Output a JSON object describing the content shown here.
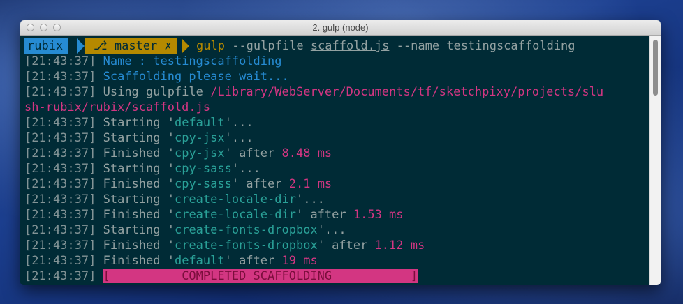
{
  "window": {
    "title": "2. gulp (node)"
  },
  "prompt": {
    "user": "rubix",
    "branch_icon": "branch-icon",
    "branch": "master",
    "dirty_mark": "✗",
    "command": "gulp",
    "arg1": "--gulpfile",
    "file": "scaffold.js",
    "arg2": "--name testingscaffolding"
  },
  "colors": {
    "background": "#002b36",
    "blue": "#268bd2",
    "teal": "#2aa198",
    "magenta": "#d33682",
    "yellow": "#b58900",
    "text": "#93a1a1"
  },
  "lines": [
    {
      "ts": "[21:43:37]",
      "text": "Name : testingscaffolding"
    },
    {
      "ts": "[21:43:37]",
      "text": "Scaffolding please wait..."
    },
    {
      "ts": "[21:43:37]",
      "pre": "Using gulpfile ",
      "path1": "/Library/WebServer/Documents/tf/sketchpixy/projects/slu"
    },
    {
      "path2": "sh-rubix/rubix/scaffold.js"
    },
    {
      "ts": "[21:43:37]",
      "pre": "Starting '",
      "task": "default",
      "post": "'..."
    },
    {
      "ts": "[21:43:37]",
      "pre": "Starting '",
      "task": "cpy-jsx",
      "post": "'..."
    },
    {
      "ts": "[21:43:37]",
      "pre": "Finished '",
      "task": "cpy-jsx",
      "post": "' after ",
      "time": "8.48 ms"
    },
    {
      "ts": "[21:43:37]",
      "pre": "Starting '",
      "task": "cpy-sass",
      "post": "'..."
    },
    {
      "ts": "[21:43:37]",
      "pre": "Finished '",
      "task": "cpy-sass",
      "post": "' after ",
      "time": "2.1 ms"
    },
    {
      "ts": "[21:43:37]",
      "pre": "Starting '",
      "task": "create-locale-dir",
      "post": "'..."
    },
    {
      "ts": "[21:43:37]",
      "pre": "Finished '",
      "task": "create-locale-dir",
      "post": "' after ",
      "time": "1.53 ms"
    },
    {
      "ts": "[21:43:37]",
      "pre": "Starting '",
      "task": "create-fonts-dropbox",
      "post": "'..."
    },
    {
      "ts": "[21:43:37]",
      "pre": "Finished '",
      "task": "create-fonts-dropbox",
      "post": "' after ",
      "time": "1.12 ms"
    },
    {
      "ts": "[21:43:37]",
      "pre": "Finished '",
      "task": "default",
      "post": "' after ",
      "time": "19 ms"
    },
    {
      "ts": "[21:43:37]",
      "banner": "[          COMPLETED SCAFFOLDING           ]"
    }
  ]
}
